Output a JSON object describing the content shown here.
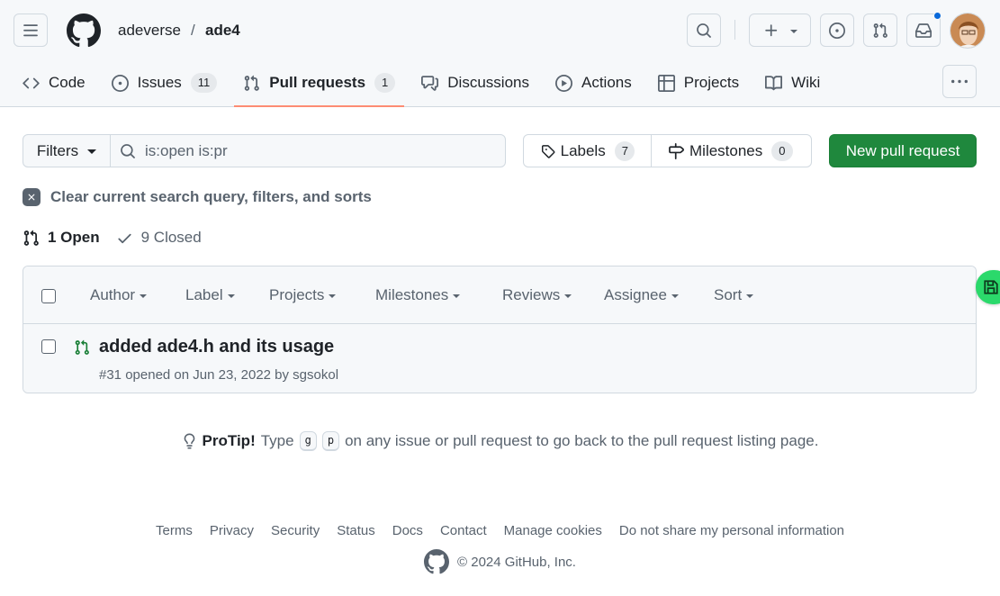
{
  "header": {
    "owner": "adeverse",
    "separator": "/",
    "repo": "ade4"
  },
  "tabs": [
    {
      "label": "Code",
      "icon": "code-icon"
    },
    {
      "label": "Issues",
      "icon": "issue-icon",
      "count": "11"
    },
    {
      "label": "Pull requests",
      "icon": "pull-request-icon",
      "count": "1",
      "active": true
    },
    {
      "label": "Discussions",
      "icon": "discussions-icon"
    },
    {
      "label": "Actions",
      "icon": "play-icon"
    },
    {
      "label": "Projects",
      "icon": "table-icon"
    },
    {
      "label": "Wiki",
      "icon": "book-icon"
    }
  ],
  "toolbar": {
    "filters_label": "Filters",
    "search_value": "is:open is:pr",
    "labels_label": "Labels",
    "labels_count": "7",
    "milestones_label": "Milestones",
    "milestones_count": "0",
    "new_pr_label": "New pull request"
  },
  "clear_label": "Clear current search query, filters, and sorts",
  "states": {
    "open": "1 Open",
    "closed": "9 Closed"
  },
  "box_filters": [
    "Author",
    "Label",
    "Projects",
    "Milestones",
    "Reviews",
    "Assignee",
    "Sort"
  ],
  "pull_requests": [
    {
      "title": "added ade4.h and its usage",
      "meta": "#31 opened on Jun 23, 2022 by sgsokol"
    }
  ],
  "protip": {
    "label": "ProTip!",
    "pre": "Type",
    "key1": "g",
    "key2": "p",
    "post": "on any issue or pull request to go back to the pull request listing page."
  },
  "footer": {
    "links": [
      "Terms",
      "Privacy",
      "Security",
      "Status",
      "Docs",
      "Contact",
      "Manage cookies",
      "Do not share my personal information"
    ],
    "copyright": "© 2024 GitHub, Inc."
  },
  "colors": {
    "primary_button": "#1f883d",
    "open_pr": "#1a7f37",
    "active_tab_underline": "#fd8c73",
    "notification": "#0969da"
  }
}
